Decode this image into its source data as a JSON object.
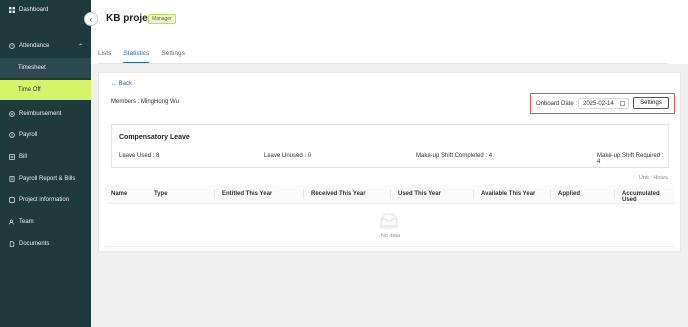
{
  "sidebar": {
    "items": [
      {
        "label": "Dashboard",
        "icon": "grid-icon"
      },
      {
        "label": "Attendance",
        "icon": "clock-icon"
      },
      {
        "label": "Timesheet"
      },
      {
        "label": "Time Off"
      },
      {
        "label": "Reimbursement",
        "icon": "coin-icon"
      },
      {
        "label": "Payroll",
        "icon": "dollar-icon"
      },
      {
        "label": "Bill",
        "icon": "bill-icon"
      },
      {
        "label": "Payroll Report & Bills",
        "icon": "report-icon"
      },
      {
        "label": "Project information",
        "icon": "folder-icon"
      },
      {
        "label": "Team",
        "icon": "team-icon"
      },
      {
        "label": "Documents",
        "icon": "document-icon"
      }
    ],
    "active_color": "#d7f26b",
    "background": "#1f3a3d"
  },
  "header": {
    "title": "KB project",
    "badge": "Manager"
  },
  "tabs": [
    "Lists",
    "Statistics",
    "Settings"
  ],
  "active_tab": "Statistics",
  "main": {
    "back": "Back",
    "members": "Members : MingHong Wu",
    "onboard_label": "Onboard Date :",
    "onboard_date": "2025-02-14",
    "settings_button": "Settings",
    "comp": {
      "title": "Compensatory Leave",
      "leave_used": "Leave Used : 8",
      "leave_unused": "Leave Unused : 0",
      "makeup_completed": "Make-up Shift Completed : 4",
      "makeup_required": "Make-up Shift Required : 4"
    },
    "unit": "Unit : Hours",
    "table": {
      "columns": [
        "Name",
        "Type",
        "Entitled This Year",
        "Received This Year",
        "Used This Year",
        "Available This Year",
        "Applied",
        "Accumulated Used"
      ],
      "empty_text": "No data"
    }
  },
  "accent": "#2f6fb2",
  "highlight_border": "#e05a4a"
}
